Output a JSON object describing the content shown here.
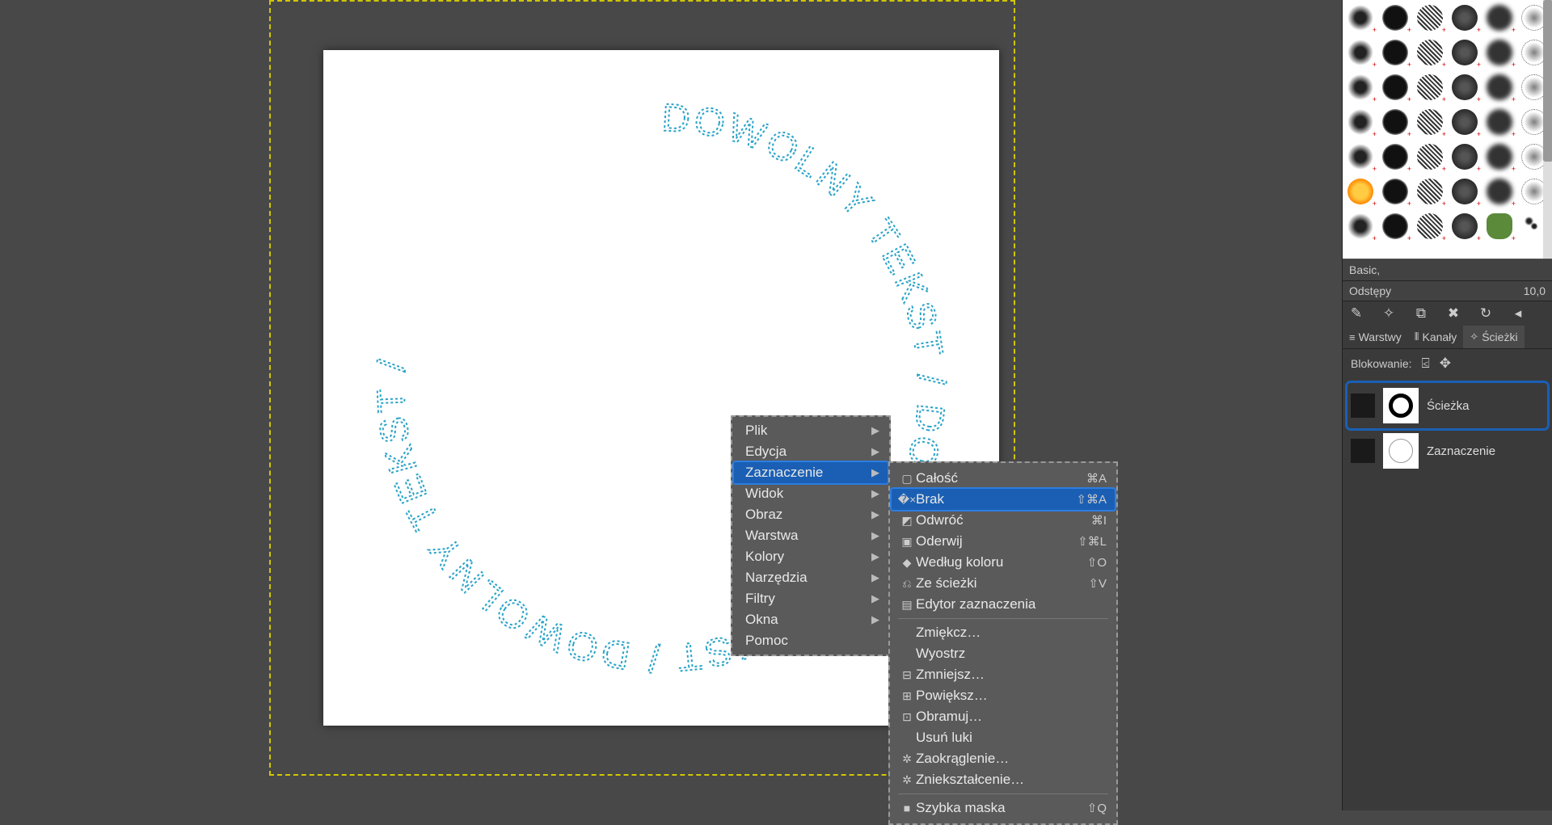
{
  "canvas": {
    "circle_text": "DOWOLNY TEKST / DOWOLNY TEKST / DOWOLNY TEKST /",
    "text_color": "#2aa3c9"
  },
  "context_menu": {
    "items": [
      {
        "label": "Plik",
        "arrow": true
      },
      {
        "label": "Edycja",
        "arrow": true
      },
      {
        "label": "Zaznaczenie",
        "arrow": true,
        "highlighted": true
      },
      {
        "label": "Widok",
        "arrow": true
      },
      {
        "label": "Obraz",
        "arrow": true
      },
      {
        "label": "Warstwa",
        "arrow": true
      },
      {
        "label": "Kolory",
        "arrow": true
      },
      {
        "label": "Narzędzia",
        "arrow": true
      },
      {
        "label": "Filtry",
        "arrow": true
      },
      {
        "label": "Okna",
        "arrow": true
      },
      {
        "label": "Pomoc"
      }
    ]
  },
  "sub_menu": {
    "items": [
      {
        "icon": "▢",
        "label": "Całość",
        "shortcut": "⌘A"
      },
      {
        "icon": "�× ",
        "label": "Brak",
        "shortcut": "⇧⌘A",
        "highlighted": true
      },
      {
        "icon": "◩",
        "label": "Odwróć",
        "shortcut": "⌘I"
      },
      {
        "icon": "▣",
        "label": "Oderwij",
        "shortcut": "⇧⌘L"
      },
      {
        "icon": "◆",
        "label": "Według koloru",
        "shortcut": "⇧O"
      },
      {
        "icon": "⎌",
        "label": "Ze ścieżki",
        "shortcut": "⇧V"
      },
      {
        "icon": "▤",
        "label": "Edytor zaznaczenia",
        "shortcut": ""
      },
      {
        "sep": true
      },
      {
        "icon": "",
        "label": "Zmiękcz…",
        "shortcut": ""
      },
      {
        "icon": "",
        "label": "Wyostrz",
        "shortcut": ""
      },
      {
        "icon": "⊟",
        "label": "Zmniejsz…",
        "shortcut": ""
      },
      {
        "icon": "⊞",
        "label": "Powiększ…",
        "shortcut": ""
      },
      {
        "icon": "⊡",
        "label": "Obramuj…",
        "shortcut": ""
      },
      {
        "icon": "",
        "label": "Usuń luki",
        "shortcut": ""
      },
      {
        "icon": "✲",
        "label": "Zaokrąglenie…",
        "shortcut": ""
      },
      {
        "icon": "✲",
        "label": "Zniekształcenie…",
        "shortcut": ""
      },
      {
        "sep": true
      },
      {
        "icon": "■",
        "label": "Szybka maska",
        "shortcut": "⇧Q"
      }
    ]
  },
  "brushes": {
    "label": "Basic,",
    "spacing_label": "Odstępy",
    "spacing_value": "10,0"
  },
  "tabs": {
    "layers": "Warstwy",
    "channels": "Kanały",
    "paths": "Ścieżki"
  },
  "lock": {
    "label": "Blokowanie:"
  },
  "paths": {
    "items": [
      {
        "name": "Ścieżka",
        "selected": true,
        "thumb": "ring"
      },
      {
        "name": "Zaznaczenie",
        "selected": false,
        "thumb": "disc"
      }
    ]
  }
}
